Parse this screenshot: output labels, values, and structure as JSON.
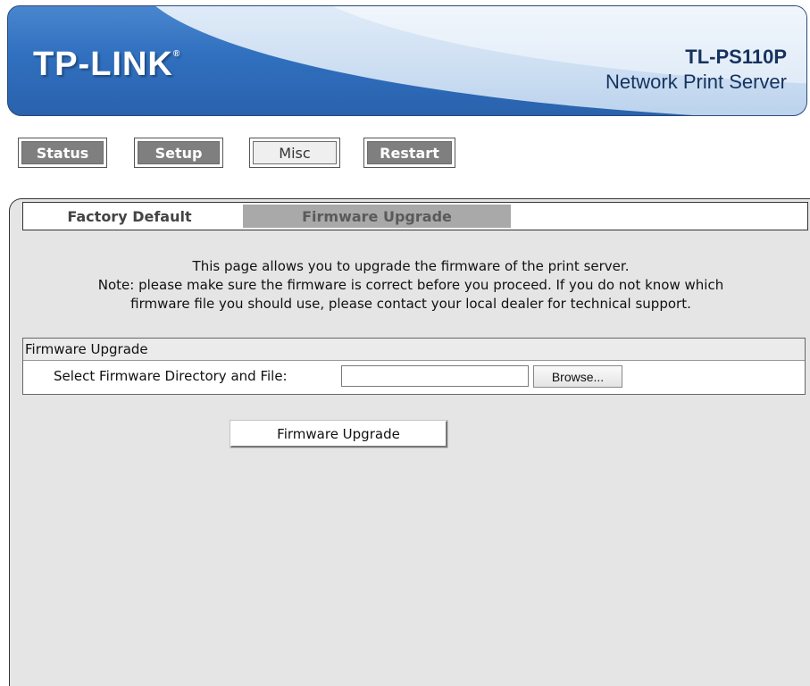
{
  "header": {
    "logo": "TP-LINK",
    "logo_mark": "®",
    "model": "TL-PS110P",
    "product": "Network Print Server"
  },
  "nav": {
    "status": "Status",
    "setup": "Setup",
    "misc": "Misc",
    "restart": "Restart",
    "active": "misc"
  },
  "tabs": {
    "factory_default": "Factory Default",
    "firmware_upgrade": "Firmware Upgrade",
    "active": "firmware_upgrade"
  },
  "description": {
    "line1": "This page allows you to upgrade the firmware of the print server.",
    "line2": "Note: please make sure the firmware is correct before you proceed. If you do not know which",
    "line3": "firmware file you should use, please contact your local dealer for technical support."
  },
  "firmware_box": {
    "title": "Firmware Upgrade",
    "label": "Select Firmware Directory and File:",
    "file_value": "",
    "browse_label": "Browse..."
  },
  "upgrade_button": "Firmware Upgrade",
  "colors": {
    "banner_blue": "#3070bf",
    "nav_gray": "#7f7f7f",
    "panel_bg": "#e5e5e5",
    "active_tab": "#a9a9a9"
  }
}
